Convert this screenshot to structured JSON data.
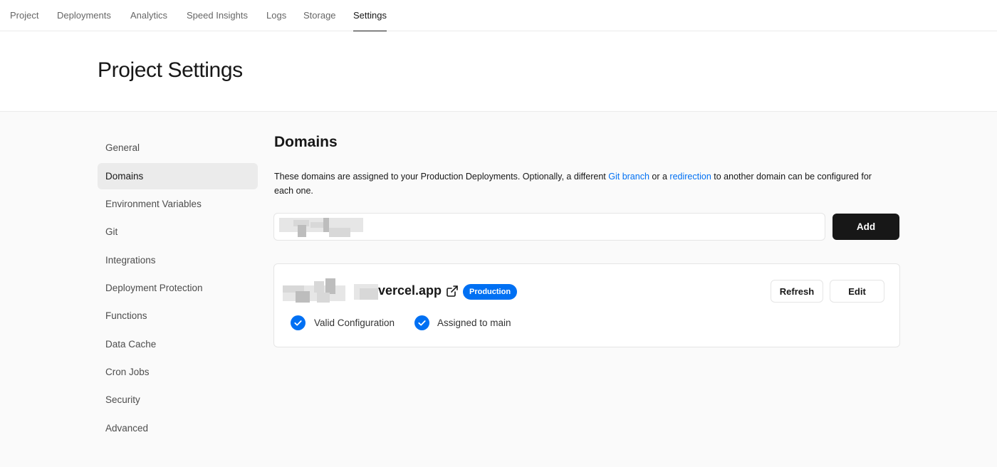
{
  "topnav": {
    "tabs": [
      {
        "label": "Project"
      },
      {
        "label": "Deployments"
      },
      {
        "label": "Analytics"
      },
      {
        "label": "Speed Insights"
      },
      {
        "label": "Logs"
      },
      {
        "label": "Storage"
      },
      {
        "label": "Settings",
        "active": true
      }
    ]
  },
  "header": {
    "title": "Project Settings"
  },
  "sidebar": {
    "items": [
      {
        "label": "General"
      },
      {
        "label": "Domains",
        "active": true
      },
      {
        "label": "Environment Variables"
      },
      {
        "label": "Git"
      },
      {
        "label": "Integrations"
      },
      {
        "label": "Deployment Protection"
      },
      {
        "label": "Functions"
      },
      {
        "label": "Data Cache"
      },
      {
        "label": "Cron Jobs"
      },
      {
        "label": "Security"
      },
      {
        "label": "Advanced"
      }
    ]
  },
  "domains": {
    "title": "Domains",
    "description": {
      "part1": "These domains are assigned to your Production Deployments. Optionally, a different ",
      "link1": "Git branch",
      "part2": " or a ",
      "link2": "redirection",
      "part3": " to another domain can be configured for each one."
    },
    "input": {
      "value": "",
      "placeholder": ""
    },
    "add_label": "Add",
    "card": {
      "domain_suffix": "vercel.app",
      "badge": "Production",
      "refresh_label": "Refresh",
      "edit_label": "Edit",
      "status_1": "Valid Configuration",
      "status_2": "Assigned to main"
    }
  },
  "colors": {
    "accent": "#0070f3",
    "primary_button": "#171717",
    "active_sidebar": "#ebebeb",
    "page_bg": "#fafafa"
  },
  "icons": {
    "external_link": "external-link-icon",
    "check": "check-circle-icon"
  }
}
